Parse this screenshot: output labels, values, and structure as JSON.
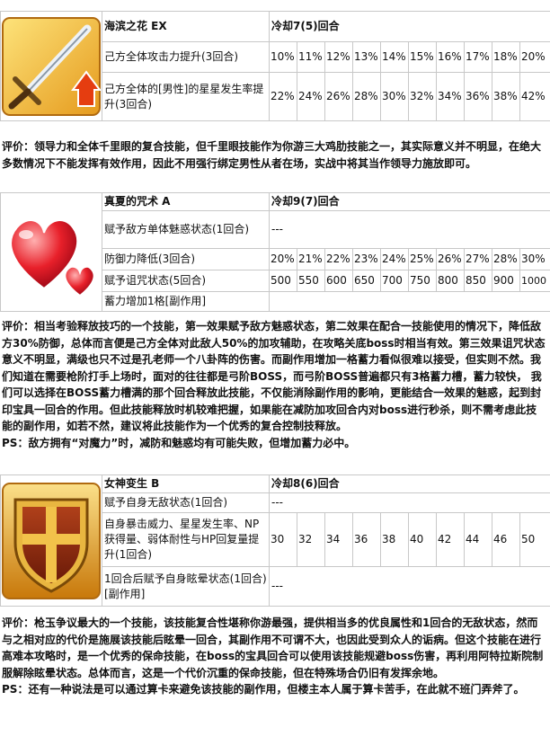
{
  "skills": [
    {
      "icon": "sword-attack-up-icon",
      "name": "海滨之花 EX",
      "cooldown": "冷却7(5)回合",
      "effects": [
        {
          "desc": "己方全体攻击力提升(3回合)",
          "values": [
            "10%",
            "11%",
            "12%",
            "13%",
            "14%",
            "15%",
            "16%",
            "17%",
            "18%",
            "20%"
          ]
        },
        {
          "desc": "己方全体的[男性]的星星发生率提升(3回合)",
          "values": [
            "22%",
            "24%",
            "26%",
            "28%",
            "30%",
            "32%",
            "34%",
            "36%",
            "38%",
            "42%"
          ]
        }
      ],
      "comment": [
        "评价：领导力和全体千里眼的复合技能，但千里眼技能作为你游三大鸡肋技能之一，其实际意义并不明显，在绝大多数情况下不能发挥有效作用，因此不用强行绑定男性从者在场，实战中将其当作领导力施放即可。"
      ]
    },
    {
      "icon": "hearts-charm-icon",
      "name": "真夏的咒术 A",
      "cooldown": "冷却9(7)回合",
      "effects": [
        {
          "desc": "赋予敌方单体魅惑状态(1回合)",
          "dash": "---"
        },
        {
          "desc": "防御力降低(3回合)",
          "values": [
            "20%",
            "21%",
            "22%",
            "23%",
            "24%",
            "25%",
            "26%",
            "27%",
            "28%",
            "30%"
          ]
        },
        {
          "desc": "赋予诅咒状态(5回合)",
          "values": [
            "500",
            "550",
            "600",
            "650",
            "700",
            "750",
            "800",
            "850",
            "900",
            "1000"
          ]
        },
        {
          "desc": "蓄力增加1格[副作用]",
          "dash": ""
        }
      ],
      "comment": [
        "评价：相当考验释放技巧的一个技能，第一效果赋予敌方魅惑状态，第二效果在配合一技能使用的情况下，降低敌方30%防御，总体而言便是己方全体对此敌人50%的加攻辅助，在攻略关底boss时相当有效。第三效果诅咒状态意义不明显，满级也只不过是孔老师一个八卦阵的伤害。而副作用增加一格蓄力看似很难以接受，但实则不然。我们知道在需要枪阶打手上场时，面对的往往都是弓阶BOSS，而弓阶BOSS普遍都只有3格蓄力槽，蓄力较快， 我们可以选择在BOSS蓄力槽满的那个回合释放此技能，不仅能消除副作用的影响，更能结合一效果的魅惑，起到封印宝具一回合的作用。但此技能释放时机较难把握，如果能在减防加攻回合内对boss进行秒杀，则不需考虑此技能的副作用，如若不然，建议将此技能作为一个优秀的复合控制技释放。",
        "PS：敌方拥有“对魔力”时，减防和魅惑均有可能失败，但增加蓄力必中。"
      ]
    },
    {
      "icon": "shield-invincible-icon",
      "name": "女神变生 B",
      "cooldown": "冷却8(6)回合",
      "effects": [
        {
          "desc": "赋予自身无敌状态(1回合)",
          "dash": "---"
        },
        {
          "desc": "自身暴击威力、星星发生率、NP获得量、弱体耐性与HP回复量提升(1回合)",
          "values": [
            "30",
            "32",
            "34",
            "36",
            "38",
            "40",
            "42",
            "44",
            "46",
            "50"
          ]
        },
        {
          "desc": "1回合后赋予自身眩晕状态(1回合)[副作用]",
          "dash": "---"
        }
      ],
      "comment": [
        "评价：枪玉争议最大的一个技能，该技能复合性堪称你游最强，提供相当多的优良属性和1回合的无敌状态，然而与之相对应的代价是施展该技能后眩晕一回合，其副作用不可谓不大，也因此受到众人的诟病。但这个技能在进行高难本攻略时，是一个优秀的保命技能，在boss的宝具回合可以使用该技能规避boss伤害，再利用阿特拉斯院制服解除眩晕状态。总体而言，这是一个代价沉重的保命技能，但在特殊场合仍旧有发挥余地。",
        "PS：还有一种说法是可以通过算卡来避免该技能的副作用，但楼主本人属于算卡苦手，在此就不班门弄斧了。"
      ]
    }
  ]
}
